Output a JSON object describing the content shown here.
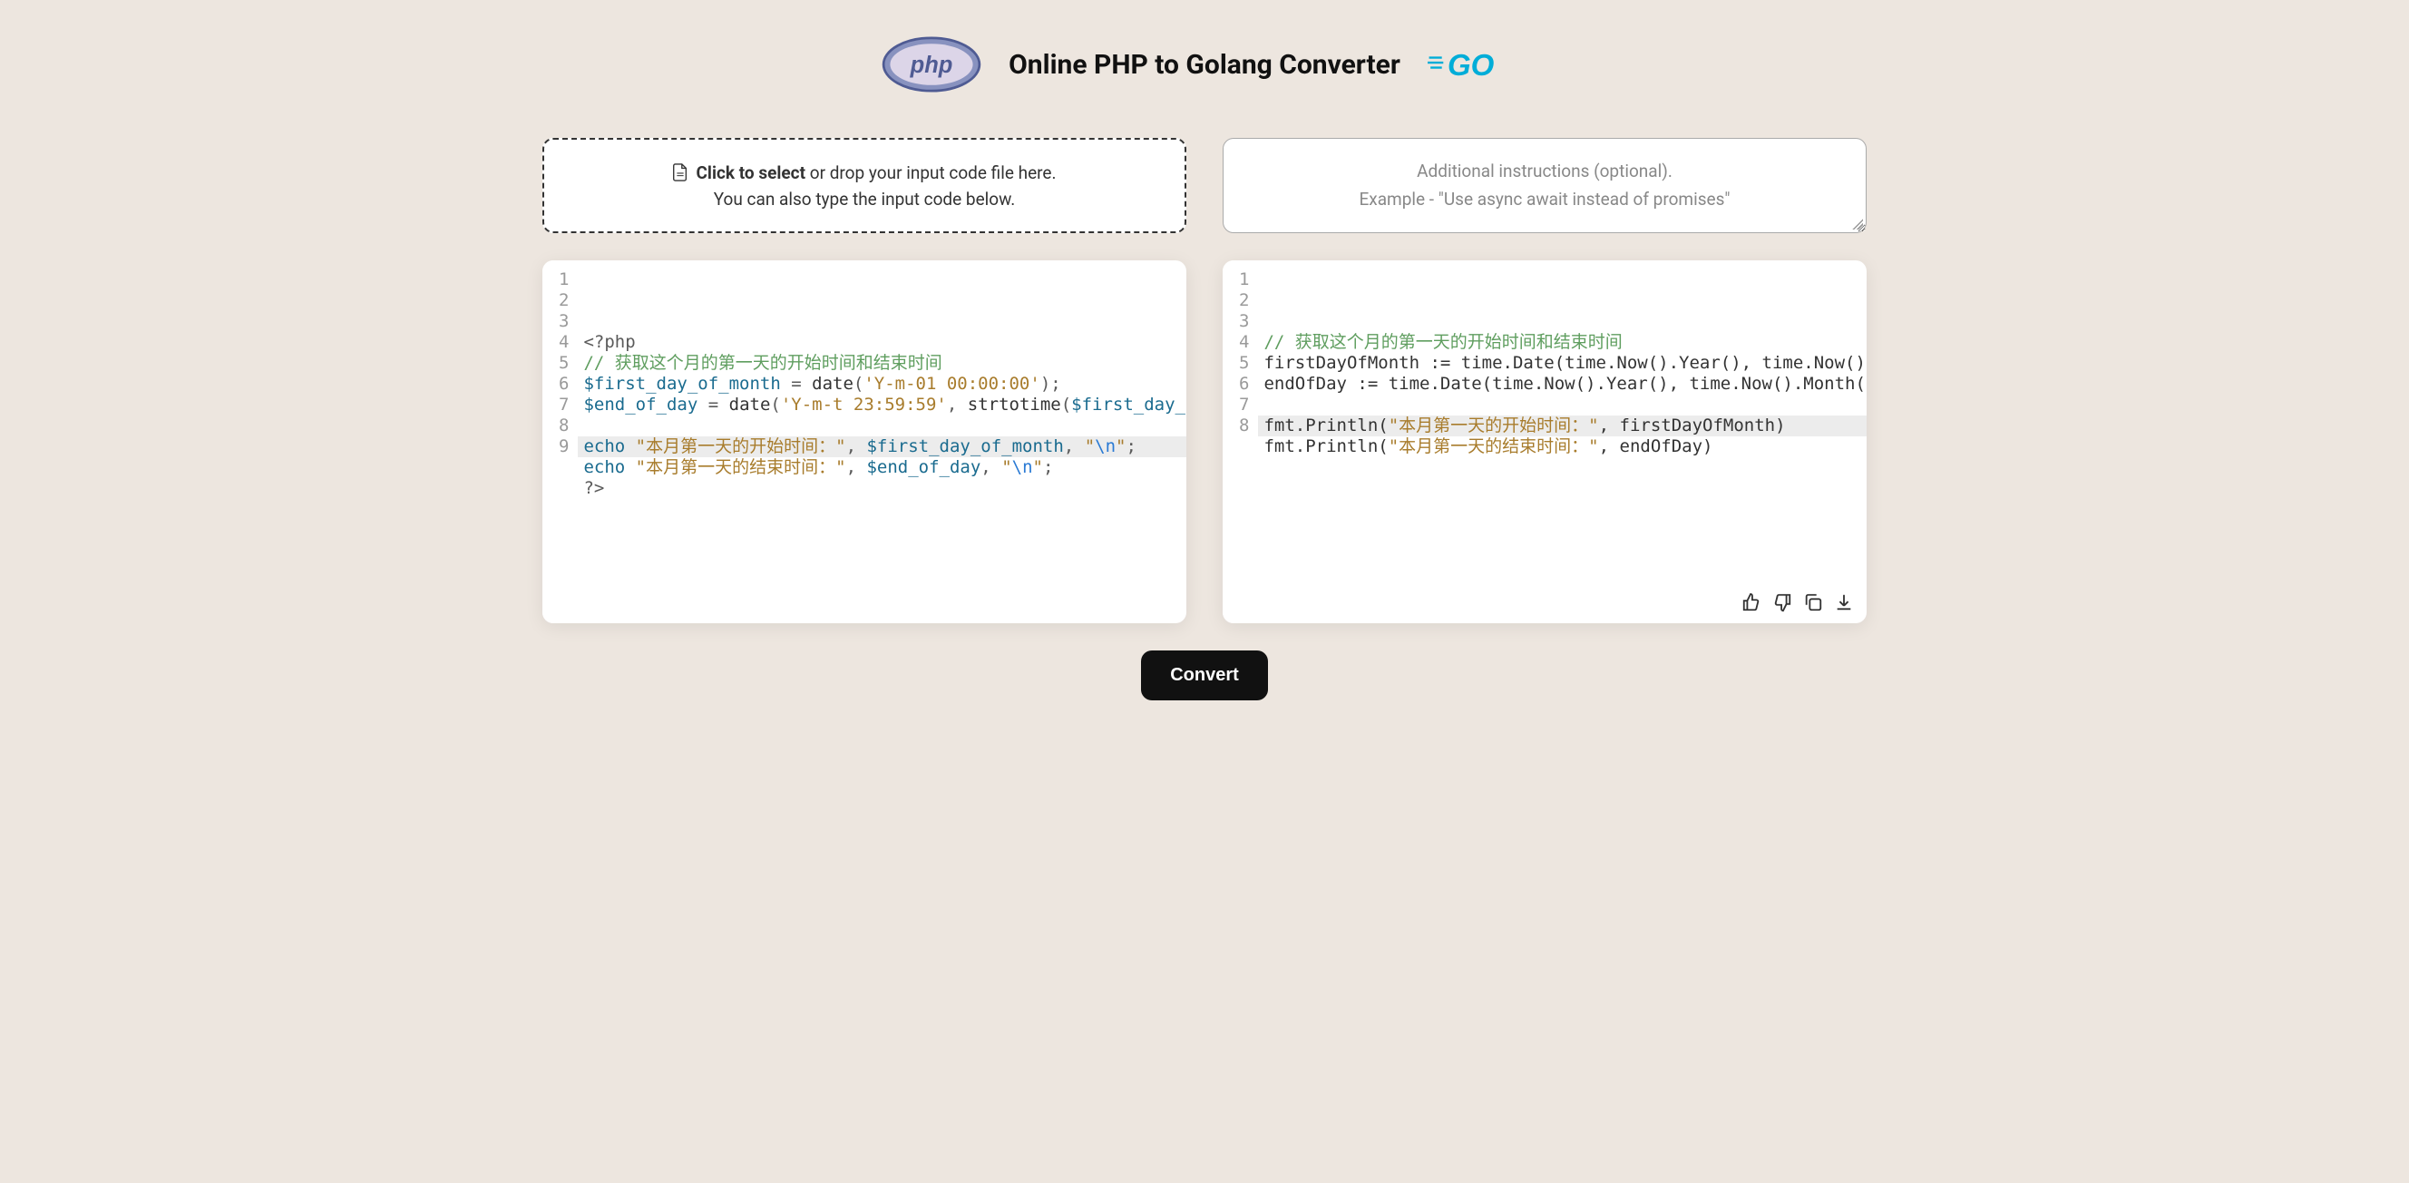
{
  "header": {
    "title": "Online PHP to Golang Converter"
  },
  "dropzone": {
    "bold": "Click to select",
    "rest": " or drop your input code file here.",
    "line2": "You can also type the input code below."
  },
  "instructions": {
    "line1": "Additional instructions (optional).",
    "line2": "Example - \"Use async await instead of promises\""
  },
  "left_editor": {
    "lines": [
      {
        "n": "1",
        "type": "raw",
        "segs": [
          {
            "c": "tag",
            "t": "<?php"
          }
        ]
      },
      {
        "n": "2",
        "type": "raw",
        "segs": [
          {
            "c": "comment",
            "t": "// 获取这个月的第一天的开始时间和结束时间"
          }
        ]
      },
      {
        "n": "3",
        "type": "raw",
        "segs": [
          {
            "c": "var",
            "t": "$first_day_of_month"
          },
          {
            "c": "punct",
            "t": " = "
          },
          {
            "c": "fn",
            "t": "date"
          },
          {
            "c": "punct",
            "t": "("
          },
          {
            "c": "str",
            "t": "'Y-m-01 00:00:00'"
          },
          {
            "c": "punct",
            "t": ");"
          }
        ]
      },
      {
        "n": "4",
        "type": "raw",
        "segs": [
          {
            "c": "var",
            "t": "$end_of_day"
          },
          {
            "c": "punct",
            "t": " = "
          },
          {
            "c": "fn",
            "t": "date"
          },
          {
            "c": "punct",
            "t": "("
          },
          {
            "c": "str",
            "t": "'Y-m-t 23:59:59'"
          },
          {
            "c": "punct",
            "t": ", "
          },
          {
            "c": "fn",
            "t": "strtotime"
          },
          {
            "c": "punct",
            "t": "("
          },
          {
            "c": "var",
            "t": "$first_day_of_m"
          }
        ]
      },
      {
        "n": "5",
        "type": "raw",
        "segs": []
      },
      {
        "n": "6",
        "type": "raw",
        "segs": [
          {
            "c": "kw",
            "t": "echo"
          },
          {
            "c": "punct",
            "t": " "
          },
          {
            "c": "str",
            "t": "\"本月第一天的开始时间：\""
          },
          {
            "c": "punct",
            "t": ", "
          },
          {
            "c": "var",
            "t": "$first_day_of_month"
          },
          {
            "c": "punct",
            "t": ", "
          },
          {
            "c": "str",
            "t": "\""
          },
          {
            "c": "esc",
            "t": "\\n"
          },
          {
            "c": "str",
            "t": "\""
          },
          {
            "c": "punct",
            "t": ";"
          }
        ]
      },
      {
        "n": "7",
        "type": "raw",
        "segs": [
          {
            "c": "kw",
            "t": "echo"
          },
          {
            "c": "punct",
            "t": " "
          },
          {
            "c": "str",
            "t": "\"本月第一天的结束时间：\""
          },
          {
            "c": "punct",
            "t": ", "
          },
          {
            "c": "var",
            "t": "$end_of_day"
          },
          {
            "c": "punct",
            "t": ", "
          },
          {
            "c": "str",
            "t": "\""
          },
          {
            "c": "esc",
            "t": "\\n"
          },
          {
            "c": "str",
            "t": "\""
          },
          {
            "c": "punct",
            "t": ";"
          }
        ]
      },
      {
        "n": "8",
        "type": "raw",
        "segs": [
          {
            "c": "tag",
            "t": "?>"
          }
        ]
      },
      {
        "n": "9",
        "type": "raw",
        "segs": []
      }
    ],
    "highlight_line": 9
  },
  "right_editor": {
    "lines": [
      {
        "n": "1",
        "type": "raw",
        "segs": [
          {
            "c": "comment",
            "t": "// 获取这个月的第一天的开始时间和结束时间"
          }
        ]
      },
      {
        "n": "2",
        "type": "raw",
        "segs": [
          {
            "c": "fn",
            "t": "firstDayOfMonth := time.Date(time.Now().Year(), time.Now().Mon"
          }
        ]
      },
      {
        "n": "3",
        "type": "raw",
        "segs": [
          {
            "c": "fn",
            "t": "endOfDay := time.Date(time.Now().Year(), time.Now().Month(), t"
          }
        ]
      },
      {
        "n": "4",
        "type": "raw",
        "segs": []
      },
      {
        "n": "5",
        "type": "raw",
        "segs": [
          {
            "c": "fn",
            "t": "fmt.Println("
          },
          {
            "c": "str",
            "t": "\"本月第一天的开始时间：\""
          },
          {
            "c": "fn",
            "t": ", firstDayOfMonth)"
          }
        ]
      },
      {
        "n": "6",
        "type": "raw",
        "segs": [
          {
            "c": "fn",
            "t": "fmt.Println("
          },
          {
            "c": "str",
            "t": "\"本月第一天的结束时间：\""
          },
          {
            "c": "fn",
            "t": ", endOfDay)"
          }
        ]
      },
      {
        "n": "7",
        "type": "raw",
        "segs": []
      },
      {
        "n": "8",
        "type": "raw",
        "segs": []
      }
    ],
    "highlight_line": 8
  },
  "convert_label": "Convert"
}
